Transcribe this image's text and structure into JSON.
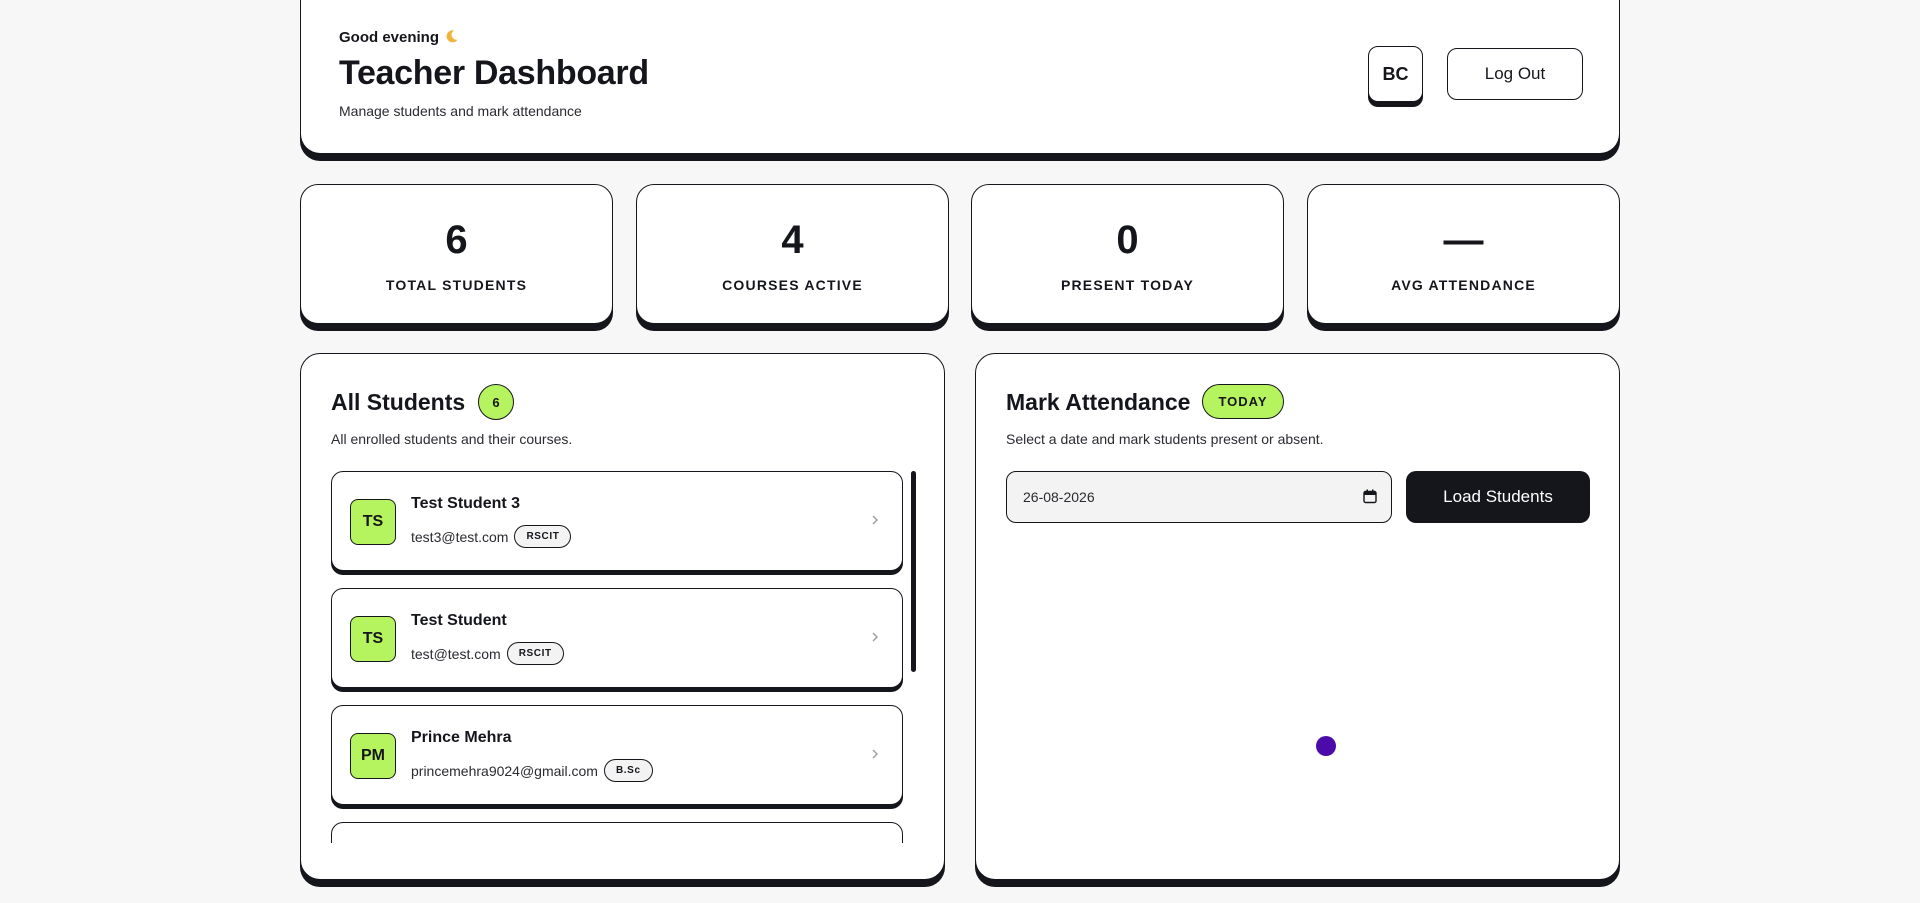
{
  "header": {
    "greeting": "Good evening",
    "title": "Teacher Dashboard",
    "subtitle": "Manage students and mark attendance",
    "avatar_initials": "BC",
    "logout_label": "Log Out"
  },
  "stats": [
    {
      "value": "6",
      "label": "TOTAL STUDENTS"
    },
    {
      "value": "4",
      "label": "COURSES ACTIVE"
    },
    {
      "value": "0",
      "label": "PRESENT TODAY"
    },
    {
      "value": "—",
      "label": "AVG ATTENDANCE"
    }
  ],
  "students_panel": {
    "title": "All Students",
    "count": "6",
    "description": "All enrolled students and their courses.",
    "students": [
      {
        "initials": "TS",
        "name": "Test Student 3",
        "email": "test3@test.com",
        "course": "RSCIT"
      },
      {
        "initials": "TS",
        "name": "Test Student",
        "email": "test@test.com",
        "course": "RSCIT"
      },
      {
        "initials": "PM",
        "name": "Prince Mehra",
        "email": "princemehra9024@gmail.com",
        "course": "B.Sc"
      }
    ]
  },
  "attendance_panel": {
    "title": "Mark Attendance",
    "badge": "TODAY",
    "description": "Select a date and mark students present or absent.",
    "date_value": "26-08-2026",
    "load_label": "Load Students"
  },
  "colors": {
    "accent": "#b5f45e",
    "ink": "#15161c",
    "spinner": "#4b0ba8",
    "header_top_border": "#2e8b1e"
  },
  "icons": {
    "greeting": "moon-icon",
    "row_action": "chevron-right-icon",
    "date_picker": "calendar-icon"
  }
}
